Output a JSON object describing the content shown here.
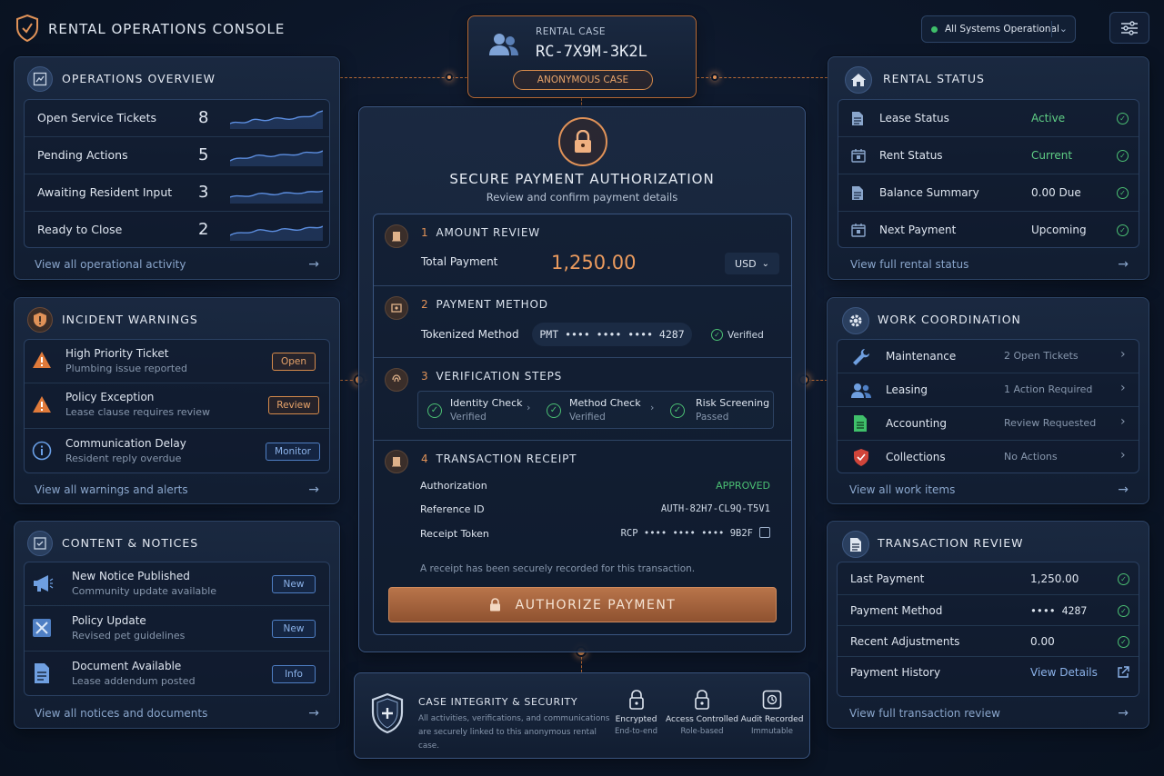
{
  "app": {
    "title": "RENTAL OPERATIONS CONSOLE"
  },
  "system_status": {
    "label": "All Systems Operational",
    "color": "#3fbf6a"
  },
  "case": {
    "header": "RENTAL CASE",
    "id": "RC-7X9M-3K2L",
    "badge": "ANONYMOUS CASE"
  },
  "overview": {
    "title": "OPERATIONS OVERVIEW",
    "items": [
      {
        "label": "Open Service Tickets",
        "value": "8"
      },
      {
        "label": "Pending Actions",
        "value": "5"
      },
      {
        "label": "Awaiting Resident Input",
        "value": "3"
      },
      {
        "label": "Ready to Close",
        "value": "2"
      }
    ],
    "link": "View all operational activity"
  },
  "incidents": {
    "title": "INCIDENT WARNINGS",
    "items": [
      {
        "title": "High Priority Ticket",
        "sub": "Plumbing issue reported",
        "action": "Open",
        "icon": "warning-icon"
      },
      {
        "title": "Policy Exception",
        "sub": "Lease clause requires review",
        "action": "Review",
        "icon": "warning-icon"
      },
      {
        "title": "Communication Delay",
        "sub": "Resident reply overdue",
        "action": "Monitor",
        "icon": "info-icon"
      }
    ],
    "link": "View all warnings and alerts"
  },
  "notices": {
    "title": "CONTENT & NOTICES",
    "items": [
      {
        "title": "New Notice Published",
        "sub": "Community update available",
        "action": "New",
        "icon": "megaphone-icon"
      },
      {
        "title": "Policy Update",
        "sub": "Revised pet guidelines",
        "action": "New",
        "icon": "policy-icon"
      },
      {
        "title": "Document Available",
        "sub": "Lease addendum posted",
        "action": "Info",
        "icon": "document-icon"
      }
    ],
    "link": "View all notices and documents"
  },
  "payment": {
    "title": "SECURE PAYMENT AUTHORIZATION",
    "subtitle": "Review and confirm payment details",
    "step1": {
      "num": "1",
      "title": "AMOUNT REVIEW",
      "label": "Total Payment",
      "amount": "1,250.00",
      "currency": "USD"
    },
    "step2": {
      "num": "2",
      "title": "PAYMENT METHOD",
      "label": "Tokenized Method",
      "method": "PMT •••• •••• •••• 4287",
      "status": "Verified"
    },
    "step3": {
      "num": "3",
      "title": "VERIFICATION STEPS",
      "checks": [
        {
          "title": "Identity Check",
          "sub": "Verified"
        },
        {
          "title": "Method Check",
          "sub": "Verified"
        },
        {
          "title": "Risk Screening",
          "sub": "Passed"
        }
      ]
    },
    "step4": {
      "num": "4",
      "title": "TRANSACTION RECEIPT",
      "rows": [
        {
          "label": "Authorization",
          "value": "APPROVED"
        },
        {
          "label": "Reference ID",
          "value": "AUTH-82H7-CL9Q-T5V1"
        },
        {
          "label": "Receipt Token",
          "value": "RCP •••• •••• •••• 9B2F"
        }
      ],
      "note": "A receipt has been securely recorded for this transaction."
    },
    "button": "AUTHORIZE PAYMENT",
    "accent": "#e09258"
  },
  "integrity": {
    "title": "CASE INTEGRITY & SECURITY",
    "desc": "All activities, verifications, and communications are securely linked to this anonymous rental case.",
    "features": [
      {
        "title": "Encrypted",
        "sub": "End-to-end"
      },
      {
        "title": "Access Controlled",
        "sub": "Role-based"
      },
      {
        "title": "Audit Recorded",
        "sub": "Immutable"
      }
    ]
  },
  "rental_status": {
    "title": "RENTAL STATUS",
    "items": [
      {
        "label": "Lease Status",
        "value": "Active"
      },
      {
        "label": "Rent Status",
        "value": "Current"
      },
      {
        "label": "Balance Summary",
        "value": "0.00 Due"
      },
      {
        "label": "Next Payment",
        "value": "Upcoming"
      }
    ],
    "link": "View full rental status"
  },
  "work": {
    "title": "WORK COORDINATION",
    "items": [
      {
        "label": "Maintenance",
        "value": "2 Open Tickets",
        "icon": "wrench-icon"
      },
      {
        "label": "Leasing",
        "value": "1 Action Required",
        "icon": "people-icon"
      },
      {
        "label": "Accounting",
        "value": "Review Requested",
        "icon": "spreadsheet-icon"
      },
      {
        "label": "Collections",
        "value": "No Actions",
        "icon": "shield-icon"
      }
    ],
    "link": "View all work items"
  },
  "txn_review": {
    "title": "TRANSACTION REVIEW",
    "items": [
      {
        "label": "Last Payment",
        "value": "1,250.00"
      },
      {
        "label": "Payment Method",
        "value": "•••• 4287"
      },
      {
        "label": "Recent Adjustments",
        "value": "0.00"
      },
      {
        "label": "Payment History",
        "value": "View Details"
      }
    ],
    "link": "View full transaction review"
  }
}
